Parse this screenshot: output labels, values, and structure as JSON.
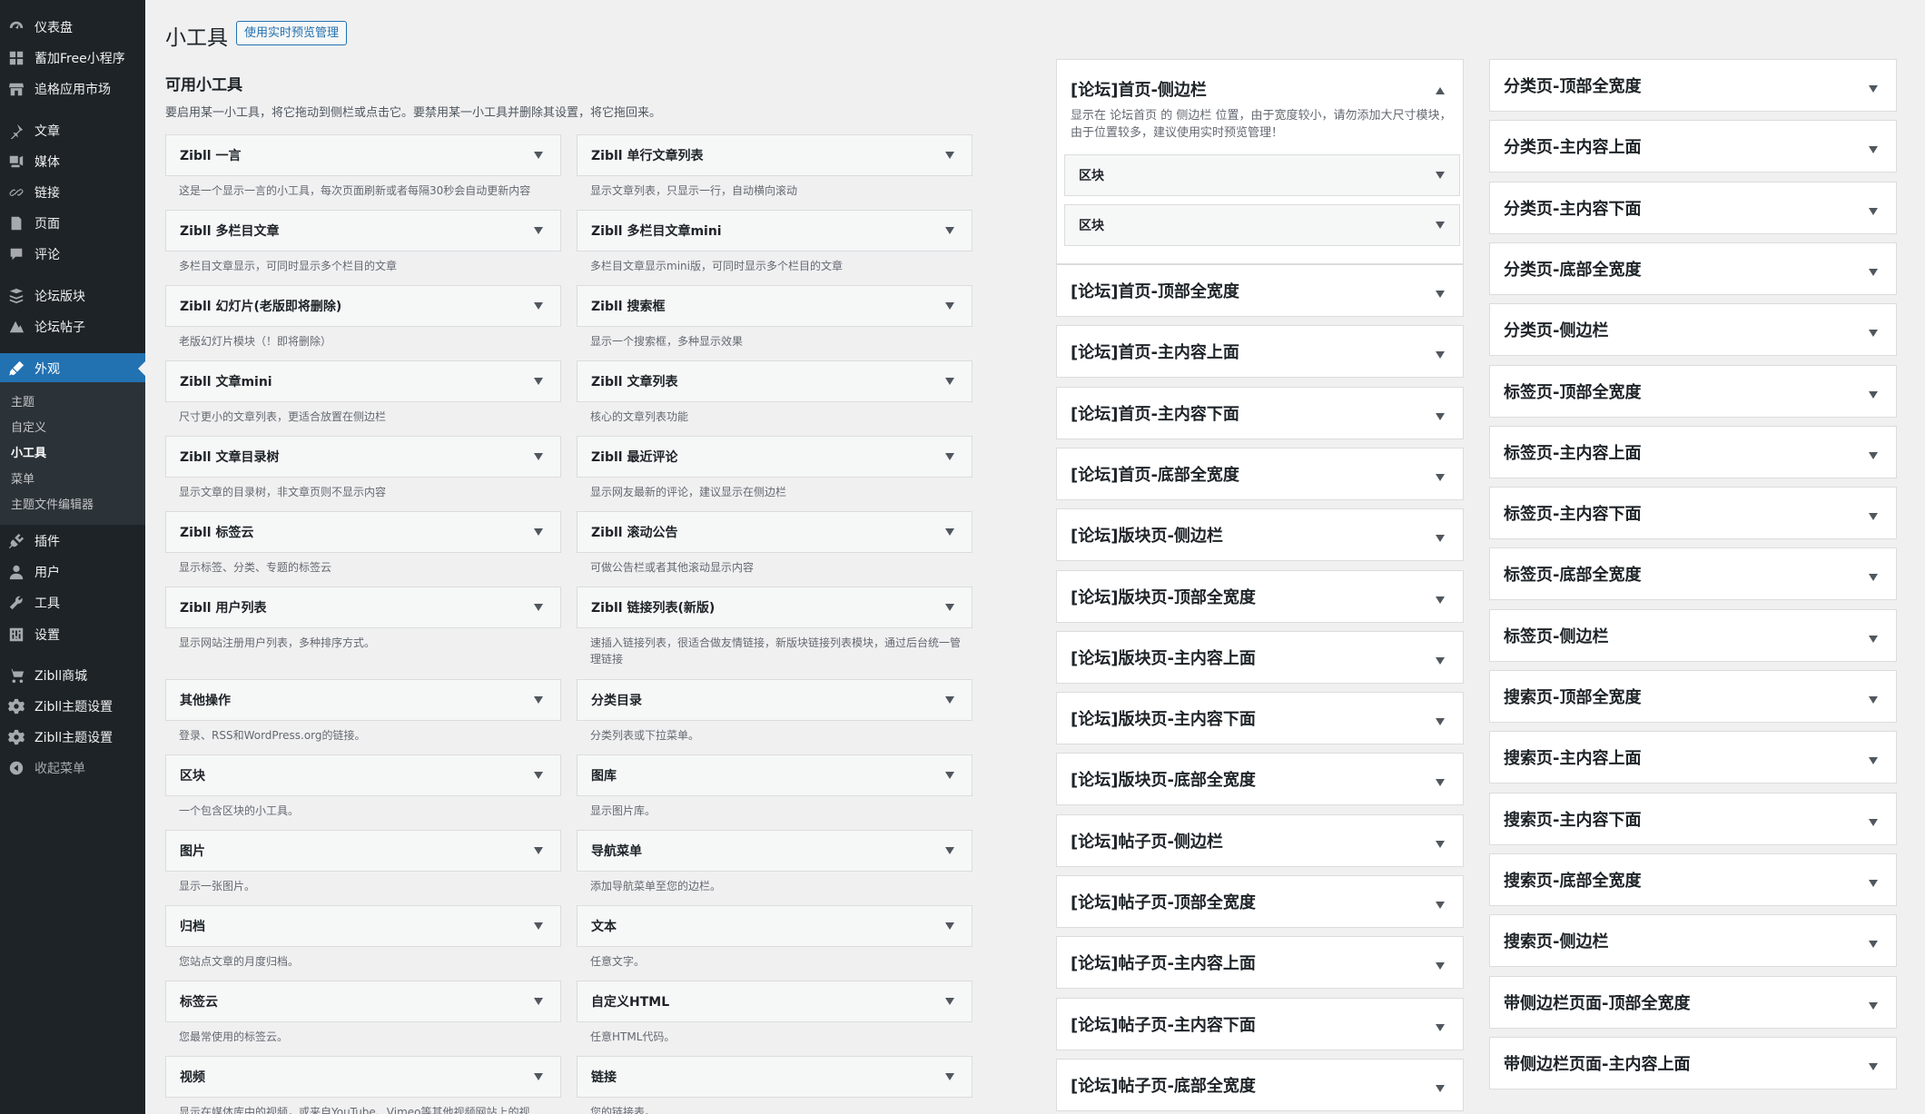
{
  "sidebar": {
    "items": [
      {
        "icon": "dashboard-icon",
        "label": "仪表盘"
      },
      {
        "icon": "grid-icon",
        "label": "蓄加Free小程序"
      },
      {
        "icon": "store-icon",
        "label": "追格应用市场"
      },
      {
        "icon": "pin-icon",
        "label": "文章"
      },
      {
        "icon": "media-icon",
        "label": "媒体"
      },
      {
        "icon": "link-icon",
        "label": "链接"
      },
      {
        "icon": "page-icon",
        "label": "页面"
      },
      {
        "icon": "comment-icon",
        "label": "评论"
      },
      {
        "icon": "forum-board-icon",
        "label": "论坛版块"
      },
      {
        "icon": "forum-post-icon",
        "label": "论坛帖子"
      },
      {
        "icon": "appearance-icon",
        "label": "外观"
      },
      {
        "icon": "plugin-icon",
        "label": "插件"
      },
      {
        "icon": "user-icon",
        "label": "用户"
      },
      {
        "icon": "wrench-icon",
        "label": "工具"
      },
      {
        "icon": "settings-icon",
        "label": "设置"
      },
      {
        "icon": "cart-icon",
        "label": "Zibll商城"
      },
      {
        "icon": "gear-icon",
        "label": "Zibll主题设置"
      },
      {
        "icon": "gear-icon",
        "label": "Zibll主题设置"
      },
      {
        "icon": "collapse-icon",
        "label": "收起菜单"
      }
    ],
    "submenu": [
      "主题",
      "自定义",
      "小工具",
      "菜单",
      "主题文件编辑器"
    ]
  },
  "header": {
    "title": "小工具",
    "live_preview_button": "使用实时预览管理"
  },
  "available": {
    "title": "可用小工具",
    "description": "要启用某一小工具，将它拖动到侧栏或点击它。要禁用某一小工具并删除其设置，将它拖回来。",
    "widgets": [
      {
        "name": "Zibll 一言",
        "desc": "这是一个显示一言的小工具，每次页面刷新或者每隔30秒会自动更新内容"
      },
      {
        "name": "Zibll 单行文章列表",
        "desc": "显示文章列表，只显示一行，自动横向滚动"
      },
      {
        "name": "Zibll 多栏目文章",
        "desc": "多栏目文章显示，可同时显示多个栏目的文章"
      },
      {
        "name": "Zibll 多栏目文章mini",
        "desc": "多栏目文章显示mini版，可同时显示多个栏目的文章"
      },
      {
        "name": "Zibll 幻灯片(老版即将删除)",
        "desc": "老版幻灯片模块（！即将删除）"
      },
      {
        "name": "Zibll 搜索框",
        "desc": "显示一个搜索框，多种显示效果"
      },
      {
        "name": "Zibll 文章mini",
        "desc": "尺寸更小的文章列表，更适合放置在侧边栏"
      },
      {
        "name": "Zibll 文章列表",
        "desc": "核心的文章列表功能"
      },
      {
        "name": "Zibll 文章目录树",
        "desc": "显示文章的目录树，非文章页则不显示内容"
      },
      {
        "name": "Zibll 最近评论",
        "desc": "显示网友最新的评论，建议显示在侧边栏"
      },
      {
        "name": "Zibll 标签云",
        "desc": "显示标签、分类、专题的标签云"
      },
      {
        "name": "Zibll 滚动公告",
        "desc": "可做公告栏或者其他滚动显示内容"
      },
      {
        "name": "Zibll 用户列表",
        "desc": "显示网站注册用户列表，多种排序方式。"
      },
      {
        "name": "Zibll 链接列表(新版)",
        "desc": "速插入链接列表，很适合做友情链接，新版块链接列表模块，通过后台统一管理链接"
      },
      {
        "name": "其他操作",
        "desc": "登录、RSS和WordPress.org的链接。"
      },
      {
        "name": "分类目录",
        "desc": "分类列表或下拉菜单。"
      },
      {
        "name": "区块",
        "desc": "一个包含区块的小工具。"
      },
      {
        "name": "图库",
        "desc": "显示图片库。"
      },
      {
        "name": "图片",
        "desc": "显示一张图片。"
      },
      {
        "name": "导航菜单",
        "desc": "添加导航菜单至您的边栏。"
      },
      {
        "name": "归档",
        "desc": "您站点文章的月度归档。"
      },
      {
        "name": "文本",
        "desc": "任意文字。"
      },
      {
        "name": "标签云",
        "desc": "您最常使用的标签云。"
      },
      {
        "name": "自定义HTML",
        "desc": "任意HTML代码。"
      },
      {
        "name": "视频",
        "desc": "显示在媒体库中的视频，或来自YouTube、Vimeo等其他视频网站上的视"
      },
      {
        "name": "链接",
        "desc": "您的链接表。"
      }
    ]
  },
  "areas_col1": {
    "open": {
      "title": "[论坛]首页-侧边栏",
      "desc": "显示在 论坛首页 的 侧边栏 位置，由于宽度较小，请勿添加大尺寸模块，由于位置较多，建议使用实时预览管理！",
      "blocks": [
        "区块",
        "区块"
      ]
    },
    "items": [
      "[论坛]首页-顶部全宽度",
      "[论坛]首页-主内容上面",
      "[论坛]首页-主内容下面",
      "[论坛]首页-底部全宽度",
      "[论坛]版块页-侧边栏",
      "[论坛]版块页-顶部全宽度",
      "[论坛]版块页-主内容上面",
      "[论坛]版块页-主内容下面",
      "[论坛]版块页-底部全宽度",
      "[论坛]帖子页-侧边栏",
      "[论坛]帖子页-顶部全宽度",
      "[论坛]帖子页-主内容上面",
      "[论坛]帖子页-主内容下面",
      "[论坛]帖子页-底部全宽度"
    ]
  },
  "areas_col2": {
    "items": [
      "分类页-顶部全宽度",
      "分类页-主内容上面",
      "分类页-主内容下面",
      "分类页-底部全宽度",
      "分类页-侧边栏",
      "标签页-顶部全宽度",
      "标签页-主内容上面",
      "标签页-主内容下面",
      "标签页-底部全宽度",
      "标签页-侧边栏",
      "搜索页-顶部全宽度",
      "搜索页-主内容上面",
      "搜索页-主内容下面",
      "搜索页-底部全宽度",
      "搜索页-侧边栏",
      "带侧边栏页面-顶部全宽度",
      "带侧边栏页面-主内容上面"
    ]
  },
  "colors": {
    "admin_bar": "#1d2327",
    "accent": "#2271b1",
    "page_bg": "#f0f0f1"
  }
}
